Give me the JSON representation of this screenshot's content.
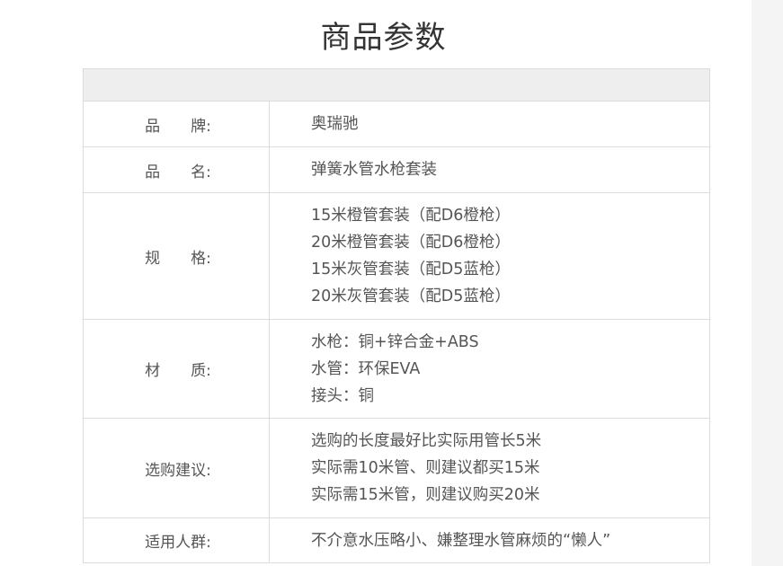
{
  "page": {
    "title": "商品参数"
  },
  "params": [
    {
      "label": "品　　牌:",
      "values": [
        "奥瑞驰"
      ]
    },
    {
      "label": "品　　名:",
      "values": [
        "弹簧水管水枪套装"
      ]
    },
    {
      "label": "规　　格:",
      "values": [
        "15米橙管套装（配D6橙枪）",
        "20米橙管套装（配D6橙枪）",
        "15米灰管套装（配D5蓝枪）",
        "20米灰管套装（配D5蓝枪）"
      ]
    },
    {
      "label": "材　　质:",
      "values": [
        "水枪：铜+锌合金+ABS",
        "水管：环保EVA",
        "接头：铜"
      ]
    },
    {
      "label": "选购建议:",
      "values": [
        "选购的长度最好比实际用管长5米",
        "实际需10米管、则建议都买15米",
        "实际需15米管，则建议购买20米"
      ]
    },
    {
      "label": "适用人群:",
      "values": [
        "不介意水压略小、嫌整理水管麻烦的“懒人”"
      ]
    }
  ]
}
